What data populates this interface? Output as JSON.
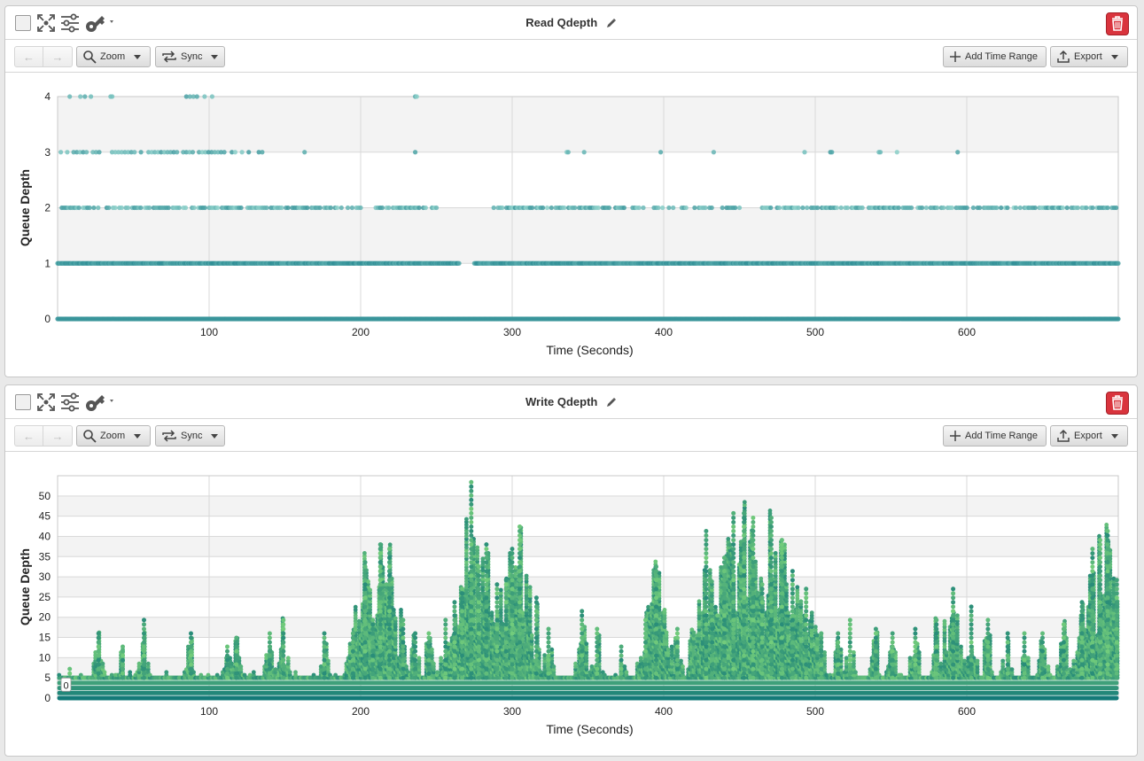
{
  "toolbar": {
    "back_label": "←",
    "forward_label": "→",
    "zoom_label": "Zoom",
    "sync_label": "Sync",
    "add_time_range_label": "Add Time Range",
    "export_label": "Export"
  },
  "colors": {
    "delete_button": "#d9343d",
    "read_points_light": "#8fd3cc",
    "read_points_dark": "#2a8a92",
    "write_points_light": "#7ed67c",
    "write_points_dark": "#137a78"
  },
  "icons": [
    "checkbox-icon",
    "expand-icon",
    "sliders-icon",
    "key-icon",
    "pencil-icon",
    "trash-icon",
    "search-icon",
    "sync-icon",
    "plus-icon",
    "upload-icon"
  ],
  "chart_data": [
    {
      "type": "scatter",
      "title": "Read Qdepth",
      "xlabel": "Time (Seconds)",
      "ylabel": "Queue Depth",
      "xlim": [
        0,
        700
      ],
      "ylim": [
        0,
        4
      ],
      "xticks": [
        100,
        200,
        300,
        400,
        500,
        600
      ],
      "yticks": [
        0,
        1,
        2,
        3,
        4
      ],
      "grid": true,
      "levels": [
        {
          "y": 0,
          "x_ranges": [
            [
              0,
              700
            ]
          ]
        },
        {
          "y": 1,
          "x_ranges": [
            [
              0,
              265
            ],
            [
              275,
              700
            ]
          ]
        },
        {
          "y": 2,
          "x_ranges": [
            [
              0,
              200
            ],
            [
              210,
              250
            ],
            [
              285,
              450
            ],
            [
              465,
              700
            ]
          ]
        },
        {
          "y": 3,
          "x_ranges": [
            [
              0,
              55
            ],
            [
              60,
              110
            ],
            [
              115,
              135
            ],
            [
              163,
              164
            ],
            [
              236,
              237
            ],
            [
              336,
              337
            ],
            [
              345,
              350
            ],
            [
              398,
              399
            ],
            [
              432,
              433
            ],
            [
              492,
              493
            ],
            [
              510,
              511
            ],
            [
              542,
              543
            ],
            [
              553,
              554
            ],
            [
              590,
              594
            ]
          ]
        },
        {
          "y": 4,
          "x_ranges": [
            [
              8,
              15
            ],
            [
              18,
              22
            ],
            [
              35,
              36
            ],
            [
              85,
              92
            ],
            [
              97,
              102
            ],
            [
              236,
              237
            ]
          ]
        }
      ]
    },
    {
      "type": "scatter",
      "title": "Write Qdepth",
      "xlabel": "Time (Seconds)",
      "ylabel": "Queue Depth",
      "xlim": [
        0,
        700
      ],
      "ylim": [
        0,
        55
      ],
      "xticks": [
        100,
        200,
        300,
        400,
        500,
        600
      ],
      "yticks": [
        0,
        5,
        10,
        15,
        20,
        25,
        30,
        35,
        40,
        45,
        50
      ],
      "grid": true,
      "annotation": "0",
      "baseline_band": [
        0,
        5
      ],
      "peaks": [
        {
          "x": 8,
          "y": 8
        },
        {
          "x": 27,
          "y": 16
        },
        {
          "x": 43,
          "y": 13
        },
        {
          "x": 57,
          "y": 20
        },
        {
          "x": 88,
          "y": 16
        },
        {
          "x": 112,
          "y": 13
        },
        {
          "x": 118,
          "y": 15
        },
        {
          "x": 140,
          "y": 16
        },
        {
          "x": 149,
          "y": 20
        },
        {
          "x": 176,
          "y": 16
        },
        {
          "x": 195,
          "y": 17
        },
        {
          "x": 203,
          "y": 34
        },
        {
          "x": 208,
          "y": 20
        },
        {
          "x": 213,
          "y": 39
        },
        {
          "x": 219,
          "y": 38
        },
        {
          "x": 228,
          "y": 20
        },
        {
          "x": 236,
          "y": 17
        },
        {
          "x": 245,
          "y": 17
        },
        {
          "x": 256,
          "y": 20
        },
        {
          "x": 262,
          "y": 24
        },
        {
          "x": 267,
          "y": 28
        },
        {
          "x": 273,
          "y": 54
        },
        {
          "x": 278,
          "y": 33
        },
        {
          "x": 283,
          "y": 39
        },
        {
          "x": 290,
          "y": 29
        },
        {
          "x": 296,
          "y": 30
        },
        {
          "x": 300,
          "y": 37
        },
        {
          "x": 305,
          "y": 43
        },
        {
          "x": 316,
          "y": 25
        },
        {
          "x": 324,
          "y": 18
        },
        {
          "x": 346,
          "y": 22
        },
        {
          "x": 356,
          "y": 18
        },
        {
          "x": 372,
          "y": 13
        },
        {
          "x": 388,
          "y": 20
        },
        {
          "x": 395,
          "y": 33
        },
        {
          "x": 409,
          "y": 18
        },
        {
          "x": 428,
          "y": 42
        },
        {
          "x": 432,
          "y": 20
        },
        {
          "x": 440,
          "y": 35
        },
        {
          "x": 446,
          "y": 46
        },
        {
          "x": 453,
          "y": 46
        },
        {
          "x": 459,
          "y": 45
        },
        {
          "x": 465,
          "y": 29
        },
        {
          "x": 471,
          "y": 45
        },
        {
          "x": 478,
          "y": 40
        },
        {
          "x": 485,
          "y": 32
        },
        {
          "x": 494,
          "y": 28
        },
        {
          "x": 504,
          "y": 16
        },
        {
          "x": 515,
          "y": 17
        },
        {
          "x": 523,
          "y": 20
        },
        {
          "x": 540,
          "y": 18
        },
        {
          "x": 551,
          "y": 17
        },
        {
          "x": 566,
          "y": 18
        },
        {
          "x": 580,
          "y": 20
        },
        {
          "x": 591,
          "y": 28
        },
        {
          "x": 603,
          "y": 23
        },
        {
          "x": 614,
          "y": 20
        },
        {
          "x": 627,
          "y": 17
        },
        {
          "x": 638,
          "y": 16
        },
        {
          "x": 650,
          "y": 16
        },
        {
          "x": 664,
          "y": 19
        },
        {
          "x": 676,
          "y": 24
        },
        {
          "x": 683,
          "y": 38
        },
        {
          "x": 688,
          "y": 40
        },
        {
          "x": 693,
          "y": 42
        },
        {
          "x": 699,
          "y": 30
        }
      ]
    }
  ]
}
